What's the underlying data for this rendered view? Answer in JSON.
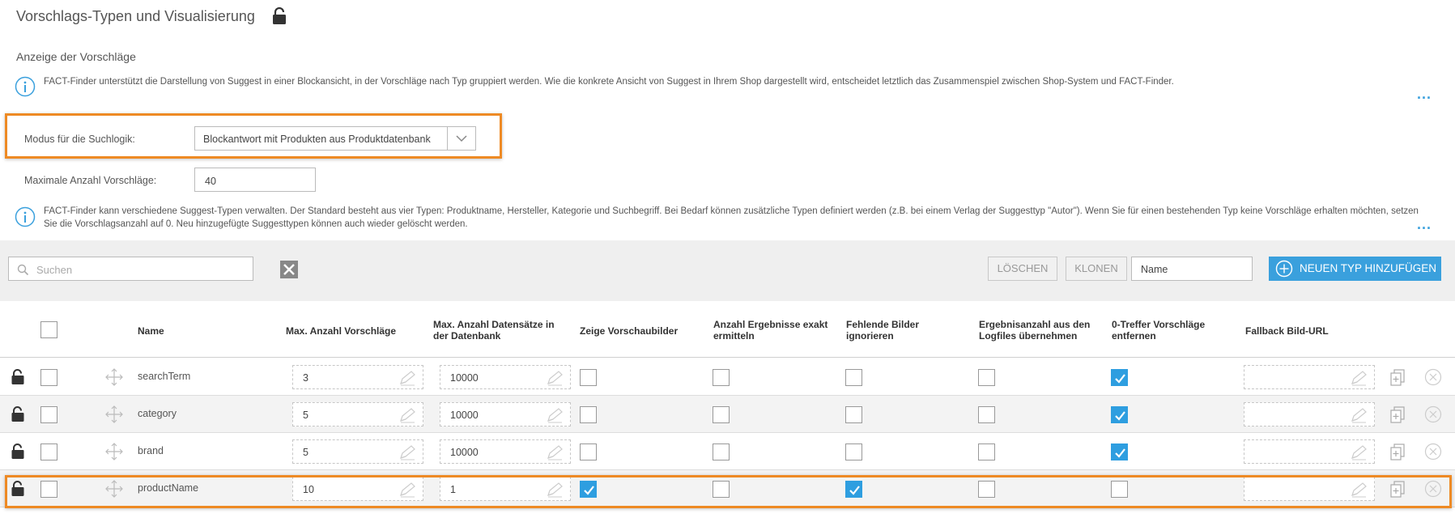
{
  "page": {
    "title": "Vorschlags-Typen und Visualisierung",
    "section_heading": "Anzeige der Vorschläge"
  },
  "info": [
    {
      "text": "FACT-Finder unterstützt die Darstellung von Suggest in einer Blockansicht, in der Vorschläge nach Typ gruppiert werden. Wie die konkrete Ansicht von Suggest in Ihrem Shop dargestellt wird, entscheidet letztlich das Zusammenspiel zwischen Shop-System und FACT-Finder.",
      "more": "..."
    },
    {
      "text": "FACT-Finder kann verschiedene Suggest-Typen verwalten. Der Standard besteht aus vier Typen: Produktname, Hersteller, Kategorie und Suchbegriff. Bei Bedarf können zusätzliche Typen definiert werden (z.B. bei einem Verlag der Suggesttyp \"Autor\"). Wenn Sie für einen bestehenden Typ keine Vorschläge erhalten möchten, setzen Sie die Vorschlagsanzahl auf 0. Neu hinzugefügte Suggesttypen können auch wieder gelöscht werden.",
      "more": "..."
    }
  ],
  "form": {
    "mode_label": "Modus für die Suchlogik:",
    "mode_value": "Blockantwort mit Produkten aus Produktdatenbank",
    "max_label": "Maximale Anzahl Vorschläge:",
    "max_value": "40"
  },
  "toolbar": {
    "search_placeholder": "Suchen",
    "delete_label": "LÖSCHEN",
    "clone_label": "KLONEN",
    "name_placeholder": "Name",
    "add_label": "NEUEN TYP HINZUFÜGEN"
  },
  "table": {
    "headers": {
      "name": "Name",
      "max_suggestions": "Max. Anzahl Vorschläge",
      "max_records_1": "Max. Anzahl Datensätze in",
      "max_records_2": "der Datenbank",
      "show_preview": "Zeige Vorschaubilder",
      "exact_count_1": "Anzahl Ergebnisse exakt",
      "exact_count_2": "ermitteln",
      "ignore_missing_1": "Fehlende Bilder",
      "ignore_missing_2": "ignorieren",
      "logfile_count_1": "Ergebnisanzahl aus den",
      "logfile_count_2": "Logfiles übernehmen",
      "remove_zero_1": "0-Treffer Vorschläge",
      "remove_zero_2": "entfernen",
      "fallback_url": "Fallback Bild-URL"
    },
    "rows": [
      {
        "name": "searchTerm",
        "max_suggestions": "3",
        "max_records": "10000",
        "show_preview": false,
        "exact_count": false,
        "ignore_missing": false,
        "logfile_count": false,
        "remove_zero": true
      },
      {
        "name": "category",
        "max_suggestions": "5",
        "max_records": "10000",
        "show_preview": false,
        "exact_count": false,
        "ignore_missing": false,
        "logfile_count": false,
        "remove_zero": true
      },
      {
        "name": "brand",
        "max_suggestions": "5",
        "max_records": "10000",
        "show_preview": false,
        "exact_count": false,
        "ignore_missing": false,
        "logfile_count": false,
        "remove_zero": true
      },
      {
        "name": "productName",
        "max_suggestions": "10",
        "max_records": "1",
        "show_preview": true,
        "exact_count": false,
        "ignore_missing": true,
        "logfile_count": false,
        "remove_zero": false
      }
    ]
  },
  "colors": {
    "accent": "#3aa0dd",
    "highlight": "#ee8a24",
    "checked": "#2e9ee0"
  }
}
